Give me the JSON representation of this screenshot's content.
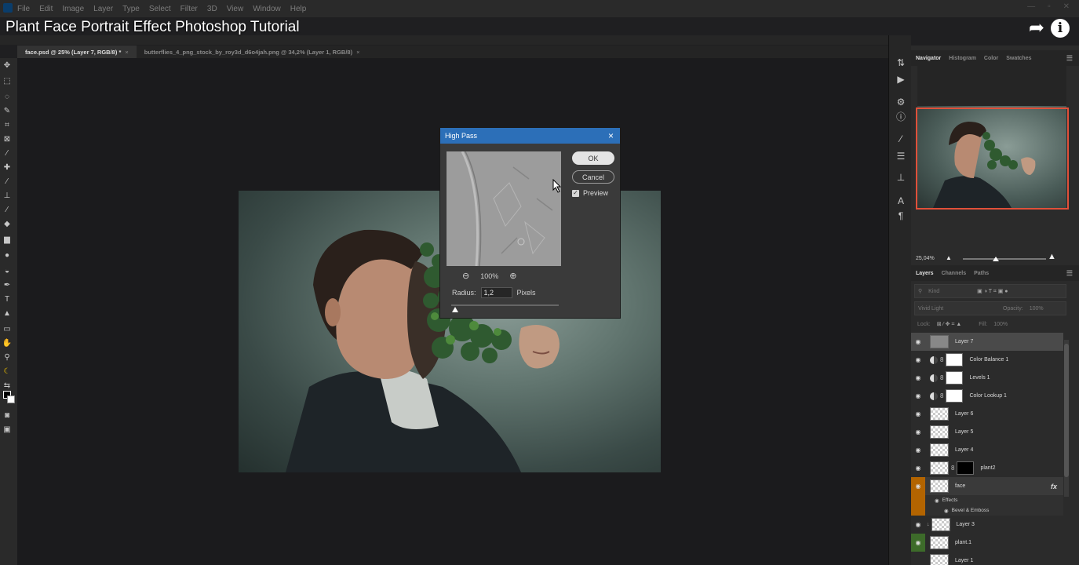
{
  "menu": {
    "items": [
      "File",
      "Edit",
      "Image",
      "Layer",
      "Type",
      "Select",
      "Filter",
      "3D",
      "View",
      "Window",
      "Help"
    ]
  },
  "video": {
    "title": "Plant Face Portrait Effect Photoshop Tutorial"
  },
  "document_tabs": [
    {
      "label": "face.psd @ 25% (Layer 7, RGB/8) *",
      "close": "×"
    },
    {
      "label": "butterflies_4_png_stock_by_roy3d_d6o4jah.png @ 34,2% (Layer 1, RGB/8)",
      "close": "×"
    }
  ],
  "dialog": {
    "title": "High Pass",
    "close": "×",
    "ok_label": "OK",
    "cancel_label": "Cancel",
    "preview_label": "Preview",
    "preview_checked": true,
    "zoom_value": "100%",
    "radius_label": "Radius:",
    "radius_value": "1,2",
    "radius_unit": "Pixels"
  },
  "panels": {
    "top_tabs": [
      "Navigator",
      "Histogram",
      "Color",
      "Swatches"
    ],
    "navigator_zoom": "25,04%",
    "layer_tabs": [
      "Layers",
      "Channels",
      "Paths"
    ],
    "filter_kind": "Kind",
    "blend_mode": "Vivid Light",
    "opacity_label": "Opacity:",
    "opacity_value": "100%",
    "lock_label": "Lock:",
    "fill_label": "Fill:",
    "fill_value": "100%"
  },
  "layers": [
    {
      "name": "Layer 7",
      "thumb": "gray",
      "selected": true
    },
    {
      "name": "Color Balance 1",
      "thumb": "adjust"
    },
    {
      "name": "Levels 1",
      "thumb": "adjust"
    },
    {
      "name": "Color Lookup 1",
      "thumb": "adjust"
    },
    {
      "name": "Layer 6",
      "thumb": "checker"
    },
    {
      "name": "Layer 5",
      "thumb": "checker"
    },
    {
      "name": "Layer 4",
      "thumb": "checker"
    },
    {
      "name": "plant2",
      "thumb": "mask"
    },
    {
      "name": "face",
      "thumb": "checker",
      "fx": "fx",
      "effects_label": "Effects",
      "effect_name": "Bevel & Emboss"
    },
    {
      "name": "Layer 3",
      "thumb": "checker"
    },
    {
      "name": "plant.1",
      "thumb": "checker"
    },
    {
      "name": "Layer 1",
      "thumb": "checker"
    }
  ]
}
